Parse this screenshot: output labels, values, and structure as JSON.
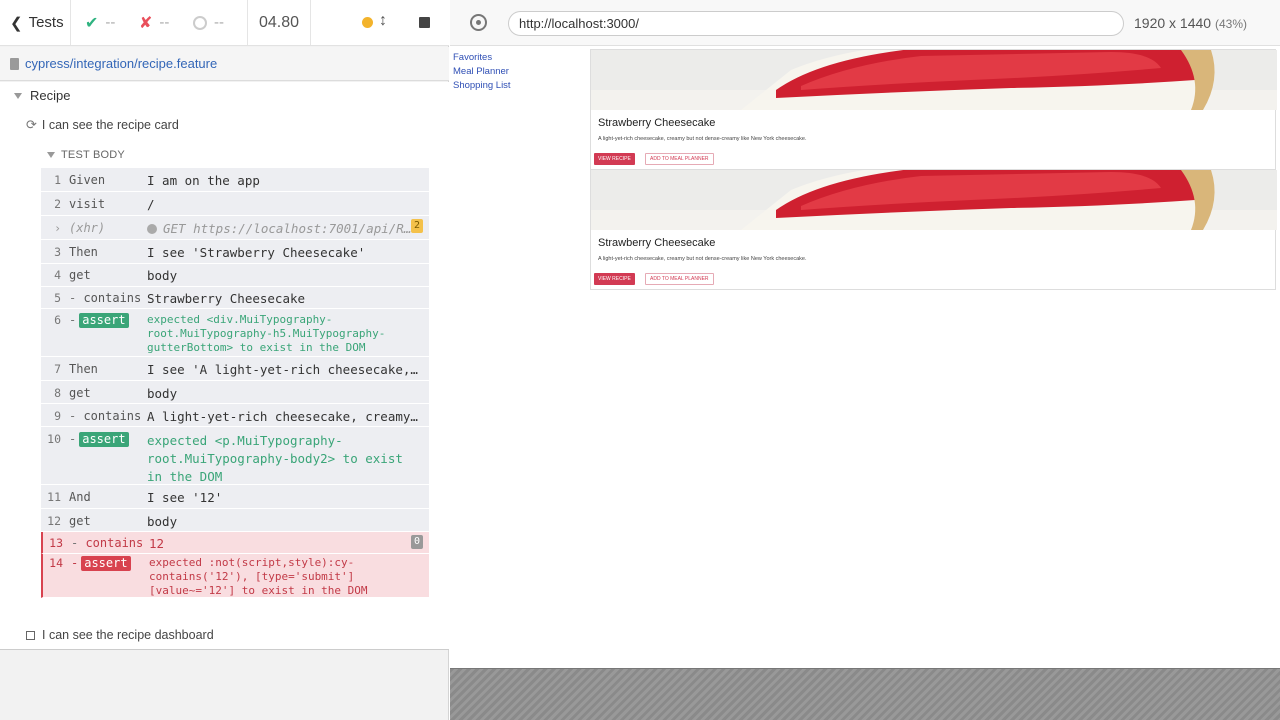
{
  "reporter": {
    "tests_label": "Tests",
    "stats": {
      "passed": "--",
      "failed": "--",
      "pending": "--"
    },
    "duration": "04.80",
    "spec_path": "cypress/integration/recipe.feature",
    "suite_title": "Recipe",
    "test_title": "I can see the recipe card",
    "test_body_label": "TEST BODY",
    "next_test_title": "I can see the recipe dashboard",
    "commands": [
      {
        "num": "1",
        "name": "Given",
        "msg": "I am on the app"
      },
      {
        "num": "2",
        "name": "visit",
        "msg": "/"
      },
      {
        "num": "",
        "name": "(xhr)",
        "msg": "GET https://localhost:7001/api/R…",
        "count": "2"
      },
      {
        "num": "3",
        "name": "Then",
        "msg": "I see 'Strawberry Cheesecake'"
      },
      {
        "num": "4",
        "name": "get",
        "msg": "body"
      },
      {
        "num": "5",
        "name": "contains",
        "msg": "Strawberry Cheesecake"
      },
      {
        "num": "6",
        "name": "assert",
        "msg": "expected <div.MuiTypography-root.MuiTypography-h5.MuiTypography-gutterBottom> to exist in the DOM"
      },
      {
        "num": "7",
        "name": "Then",
        "msg": "I see 'A light-yet-rich cheesecake, …"
      },
      {
        "num": "8",
        "name": "get",
        "msg": "body"
      },
      {
        "num": "9",
        "name": "contains",
        "msg": "A light-yet-rich cheesecake, creamy …"
      },
      {
        "num": "10",
        "name": "assert",
        "msg": "expected <p.MuiTypography-root.MuiTypography-body2> to exist in the DOM"
      },
      {
        "num": "11",
        "name": "And",
        "msg": "I see '12'"
      },
      {
        "num": "12",
        "name": "get",
        "msg": "body"
      },
      {
        "num": "13",
        "name": "contains",
        "msg": "12",
        "count": "0"
      },
      {
        "num": "14",
        "name": "assert",
        "msg": "expected :not(script,style):cy-contains('12'), [type='submit'][value~='12'] to exist in the DOM"
      }
    ]
  },
  "aut": {
    "url": "http://localhost:3000/",
    "viewport": "1920 x 1440",
    "scale": "(43%)",
    "nav": [
      "Favorites",
      "Meal Planner",
      "Shopping List"
    ],
    "cards": [
      {
        "title": "Strawberry Cheesecake",
        "description": "A light-yet-rich cheesecake, creamy but not dense-creamy like New York cheesecake.",
        "view_label": "VIEW RECIPE",
        "add_label": "ADD TO MEAL PLANNER"
      },
      {
        "title": "Strawberry Cheesecake",
        "description": "A light-yet-rich cheesecake, creamy but not dense-creamy like New York cheesecake.",
        "view_label": "VIEW RECIPE",
        "add_label": "ADD TO MEAL PLANNER"
      }
    ]
  },
  "colors": {
    "pass": "#2fb380",
    "fail": "#e94f5b",
    "running": "#f3b32b",
    "link": "#3366b7",
    "assert_pass": "#3aa578",
    "assert_fail": "#d8424f",
    "recipe_button": "#d23a53"
  },
  "icons": {
    "back": "chevron-left-icon",
    "passed": "check-icon",
    "failed": "x-icon",
    "pending": "circle-notch-icon",
    "scroll": "arrows-vertical-icon",
    "stop": "stop-icon",
    "spec_file": "file-icon",
    "test_state": "refresh-icon",
    "selector": "crosshair-icon"
  }
}
